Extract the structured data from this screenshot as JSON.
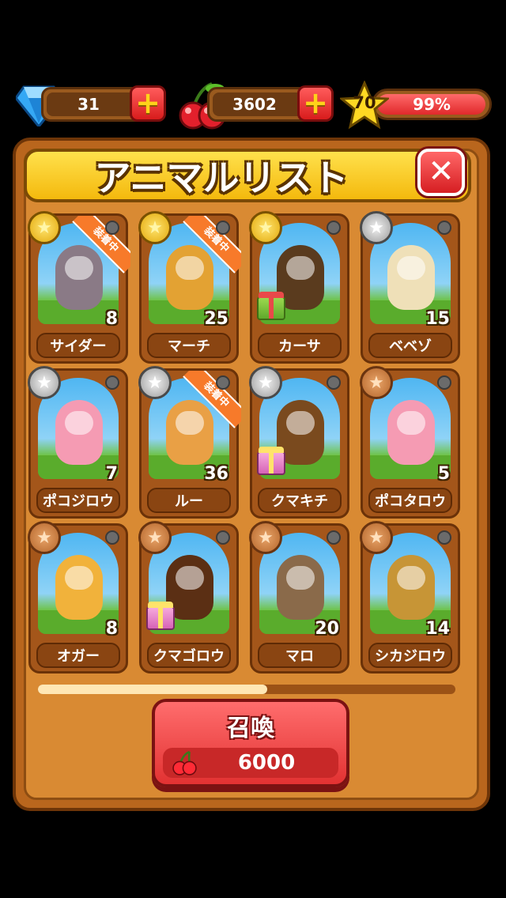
{
  "status": {
    "gems": "31",
    "cherries": "3602",
    "level": "70",
    "xp_percent_text": "99%",
    "xp_fraction": 0.99
  },
  "panel": {
    "title": "アニマルリスト",
    "close_icon": "close-icon"
  },
  "equipped_label": "装着中",
  "animals": [
    {
      "name": "サイダー",
      "level": "8",
      "medal": "gold",
      "equipped": true,
      "gift": false,
      "color": "#8a7a86"
    },
    {
      "name": "マーチ",
      "level": "25",
      "medal": "gold",
      "equipped": true,
      "gift": false,
      "color": "#e3a233"
    },
    {
      "name": "カーサ",
      "level": "",
      "medal": "gold",
      "equipped": false,
      "gift": "green",
      "color": "#5a3b1e"
    },
    {
      "name": "ベベゾ",
      "level": "15",
      "medal": "silver",
      "equipped": false,
      "gift": false,
      "color": "#efe0b8"
    },
    {
      "name": "ポコジロウ",
      "level": "7",
      "medal": "silver",
      "equipped": false,
      "gift": false,
      "color": "#f59bb3"
    },
    {
      "name": "ルー",
      "level": "36",
      "medal": "silver",
      "equipped": true,
      "gift": false,
      "color": "#e9a045"
    },
    {
      "name": "クマキチ",
      "level": "",
      "medal": "silver",
      "equipped": false,
      "gift": "pink",
      "color": "#7a4a1e"
    },
    {
      "name": "ポコタロウ",
      "level": "5",
      "medal": "bronze",
      "equipped": false,
      "gift": false,
      "color": "#f59bb3"
    },
    {
      "name": "オガー",
      "level": "8",
      "medal": "bronze",
      "equipped": false,
      "gift": false,
      "color": "#f1b23b"
    },
    {
      "name": "クマゴロウ",
      "level": "",
      "medal": "bronze",
      "equipped": false,
      "gift": "pink",
      "color": "#5b2f14"
    },
    {
      "name": "マロ",
      "level": "20",
      "medal": "bronze",
      "equipped": false,
      "gift": false,
      "color": "#8a6a4a"
    },
    {
      "name": "シカジロウ",
      "level": "14",
      "medal": "bronze",
      "equipped": false,
      "gift": false,
      "color": "#c79536"
    }
  ],
  "scroll_fraction": 0.55,
  "summon": {
    "label": "召喚",
    "cost": "6000"
  },
  "colors": {
    "panel": "#d98a33",
    "title_bar": "#f4b90d",
    "button_red": "#e23232"
  }
}
